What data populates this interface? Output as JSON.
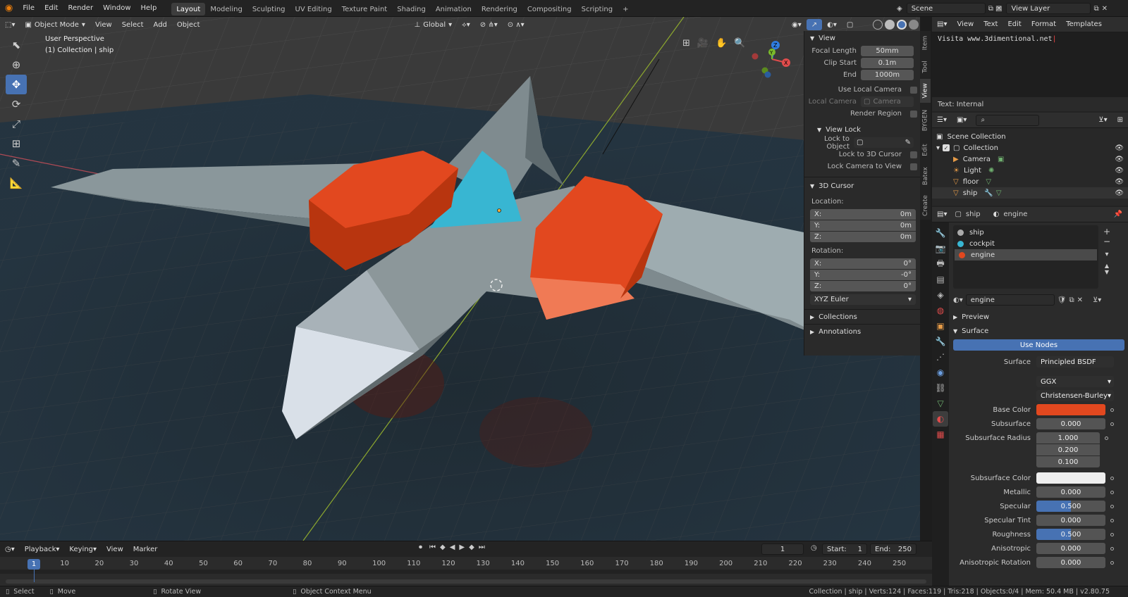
{
  "topbar": {
    "menus": [
      "File",
      "Edit",
      "Render",
      "Window",
      "Help"
    ],
    "workspaces": [
      "Layout",
      "Modeling",
      "Sculpting",
      "UV Editing",
      "Texture Paint",
      "Shading",
      "Animation",
      "Rendering",
      "Compositing",
      "Scripting"
    ],
    "active_workspace": "Layout",
    "add_tab": "+",
    "scene": "Scene",
    "view_layer": "View Layer"
  },
  "viewport": {
    "mode": "Object Mode",
    "menus": [
      "View",
      "Select",
      "Add",
      "Object"
    ],
    "transform": "Global",
    "overlay_title": "User Perspective",
    "overlay_sub": "(1) Collection | ship",
    "gizmo": {
      "x": "X",
      "y": "Y",
      "z": "Z"
    },
    "colors": {
      "bg": "#393939",
      "ship": "#8f999c",
      "engine": "#e2481f",
      "cockpit": "#38b6d2"
    }
  },
  "npanel": {
    "tabs": [
      "Item",
      "Tool",
      "View",
      "BYGEN",
      "Edit",
      "Batex",
      "Create"
    ],
    "active_tab": "View",
    "view_header": "View",
    "focal_length_label": "Focal Length",
    "focal_length": "50mm",
    "clip_start_label": "Clip Start",
    "clip_start": "0.1m",
    "end_label": "End",
    "end": "1000m",
    "use_local_camera": "Use Local Camera",
    "local_camera_label": "Local Camera",
    "local_camera": "Camera",
    "render_region": "Render Region",
    "view_lock_header": "View Lock",
    "lock_to_object": "Lock to Object",
    "lock_3d_cursor": "Lock to 3D Cursor",
    "lock_camera": "Lock Camera to View",
    "cursor_header": "3D Cursor",
    "location_label": "Location:",
    "loc": [
      {
        "axis": "X:",
        "val": "0m"
      },
      {
        "axis": "Y:",
        "val": "0m"
      },
      {
        "axis": "Z:",
        "val": "0m"
      }
    ],
    "rotation_label": "Rotation:",
    "rot": [
      {
        "axis": "X:",
        "val": "0°"
      },
      {
        "axis": "Y:",
        "val": "-0°"
      },
      {
        "axis": "Z:",
        "val": "0°"
      }
    ],
    "rotation_mode": "XYZ Euler",
    "collections": "Collections",
    "annotations": "Annotations"
  },
  "text_editor": {
    "menus": [
      "View",
      "Text",
      "Edit",
      "Format",
      "Templates"
    ],
    "content": "Visita www.3dimentional.net",
    "footer": "Text: Internal"
  },
  "outliner": {
    "scene_collection": "Scene Collection",
    "collection": "Collection",
    "items": [
      "Camera",
      "Light",
      "floor",
      "ship"
    ]
  },
  "properties": {
    "breadcrumb_object": "ship",
    "breadcrumb_material": "engine",
    "slots": [
      "ship",
      "cockpit",
      "engine"
    ],
    "active_slot": "engine",
    "material_name": "engine",
    "preview": "Preview",
    "surface_header": "Surface",
    "use_nodes": "Use Nodes",
    "surface_label": "Surface",
    "surface_value": "Principled BSDF",
    "distribution": "GGX",
    "subsurface_method": "Christensen-Burley",
    "base_color_label": "Base Color",
    "base_color": "#e2481f",
    "subsurface_label": "Subsurface",
    "subsurface": "0.000",
    "subsurface_radius_label": "Subsurface Radius",
    "subsurface_radius": [
      "1.000",
      "0.200",
      "0.100"
    ],
    "subsurface_color_label": "Subsurface Color",
    "subsurface_color": "#eeeeee",
    "metallic_label": "Metallic",
    "metallic": "0.000",
    "specular_label": "Specular",
    "specular": "0.500",
    "specular_tint_label": "Specular Tint",
    "specular_tint": "0.000",
    "roughness_label": "Roughness",
    "roughness": "0.500",
    "anisotropic_label": "Anisotropic",
    "anisotropic": "0.000",
    "aniso_rot_label": "Anisotropic Rotation",
    "aniso_rot": "0.000"
  },
  "timeline": {
    "menus": [
      "Playback",
      "Keying",
      "View",
      "Marker"
    ],
    "current_frame": "1",
    "start_label": "Start:",
    "start": "1",
    "end_label": "End:",
    "end": "250",
    "ticks": [
      "1",
      "10",
      "20",
      "30",
      "40",
      "50",
      "60",
      "70",
      "80",
      "90",
      "100",
      "110",
      "120",
      "130",
      "140",
      "150",
      "160",
      "170",
      "180",
      "190",
      "200",
      "210",
      "220",
      "230",
      "240",
      "250"
    ]
  },
  "status": {
    "select": "Select",
    "move": "Move",
    "rotate": "Rotate View",
    "context": "Object Context Menu",
    "stats": "Collection | ship | Verts:124 | Faces:119 | Tris:218 | Objects:0/4 | Mem: 50.4 MB | v2.80.75"
  }
}
